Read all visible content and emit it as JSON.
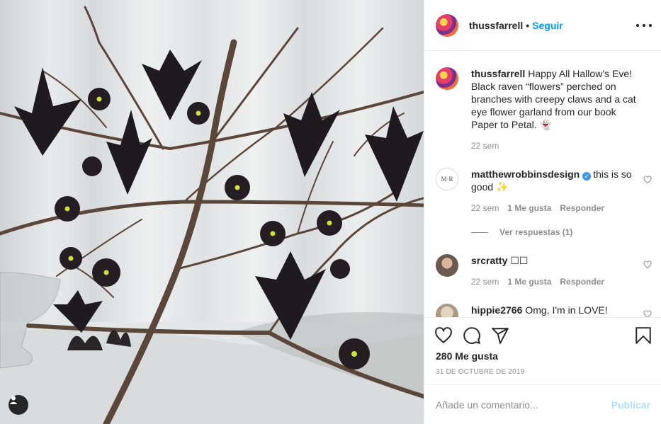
{
  "post": {
    "username": "thussfarrell",
    "dot": "•",
    "follow_label": "Seguir"
  },
  "caption": {
    "username": "thussfarrell",
    "text": "Happy All Hallow’s Eve! Black raven “flowers” perched on branches with creepy claws and a cat eye flower garland from our book Paper to Petal. 👻",
    "time": "22 sem"
  },
  "comments": [
    {
      "username": "matthewrobbinsdesign",
      "verified": true,
      "text": "this is so good ✨",
      "time": "22 sem",
      "likes": "1 Me gusta",
      "reply": "Responder",
      "avatar_text": "M·R"
    },
    {
      "username": "srcratty",
      "text": "☐☐",
      "time": "22 sem",
      "likes": "1 Me gusta",
      "reply": "Responder"
    },
    {
      "username": "hippie2766",
      "text": "Omg, I'm in LOVE!"
    }
  ],
  "view_replies": "Ver respuestas (1)",
  "likes_count": "280 Me gusta",
  "date": "31 DE OCTUBRE DE 2019",
  "composer": {
    "placeholder": "Añade un comentario...",
    "publish": "Publicar"
  },
  "colors": {
    "accent": "#0095f6",
    "publish_disabled": "#b2dffc",
    "muted": "#8e8e8e",
    "text": "#262626"
  },
  "icons": [
    "user-tag-icon",
    "more-options-icon",
    "heart-icon",
    "comment-icon",
    "share-icon",
    "bookmark-icon",
    "verified-icon"
  ]
}
